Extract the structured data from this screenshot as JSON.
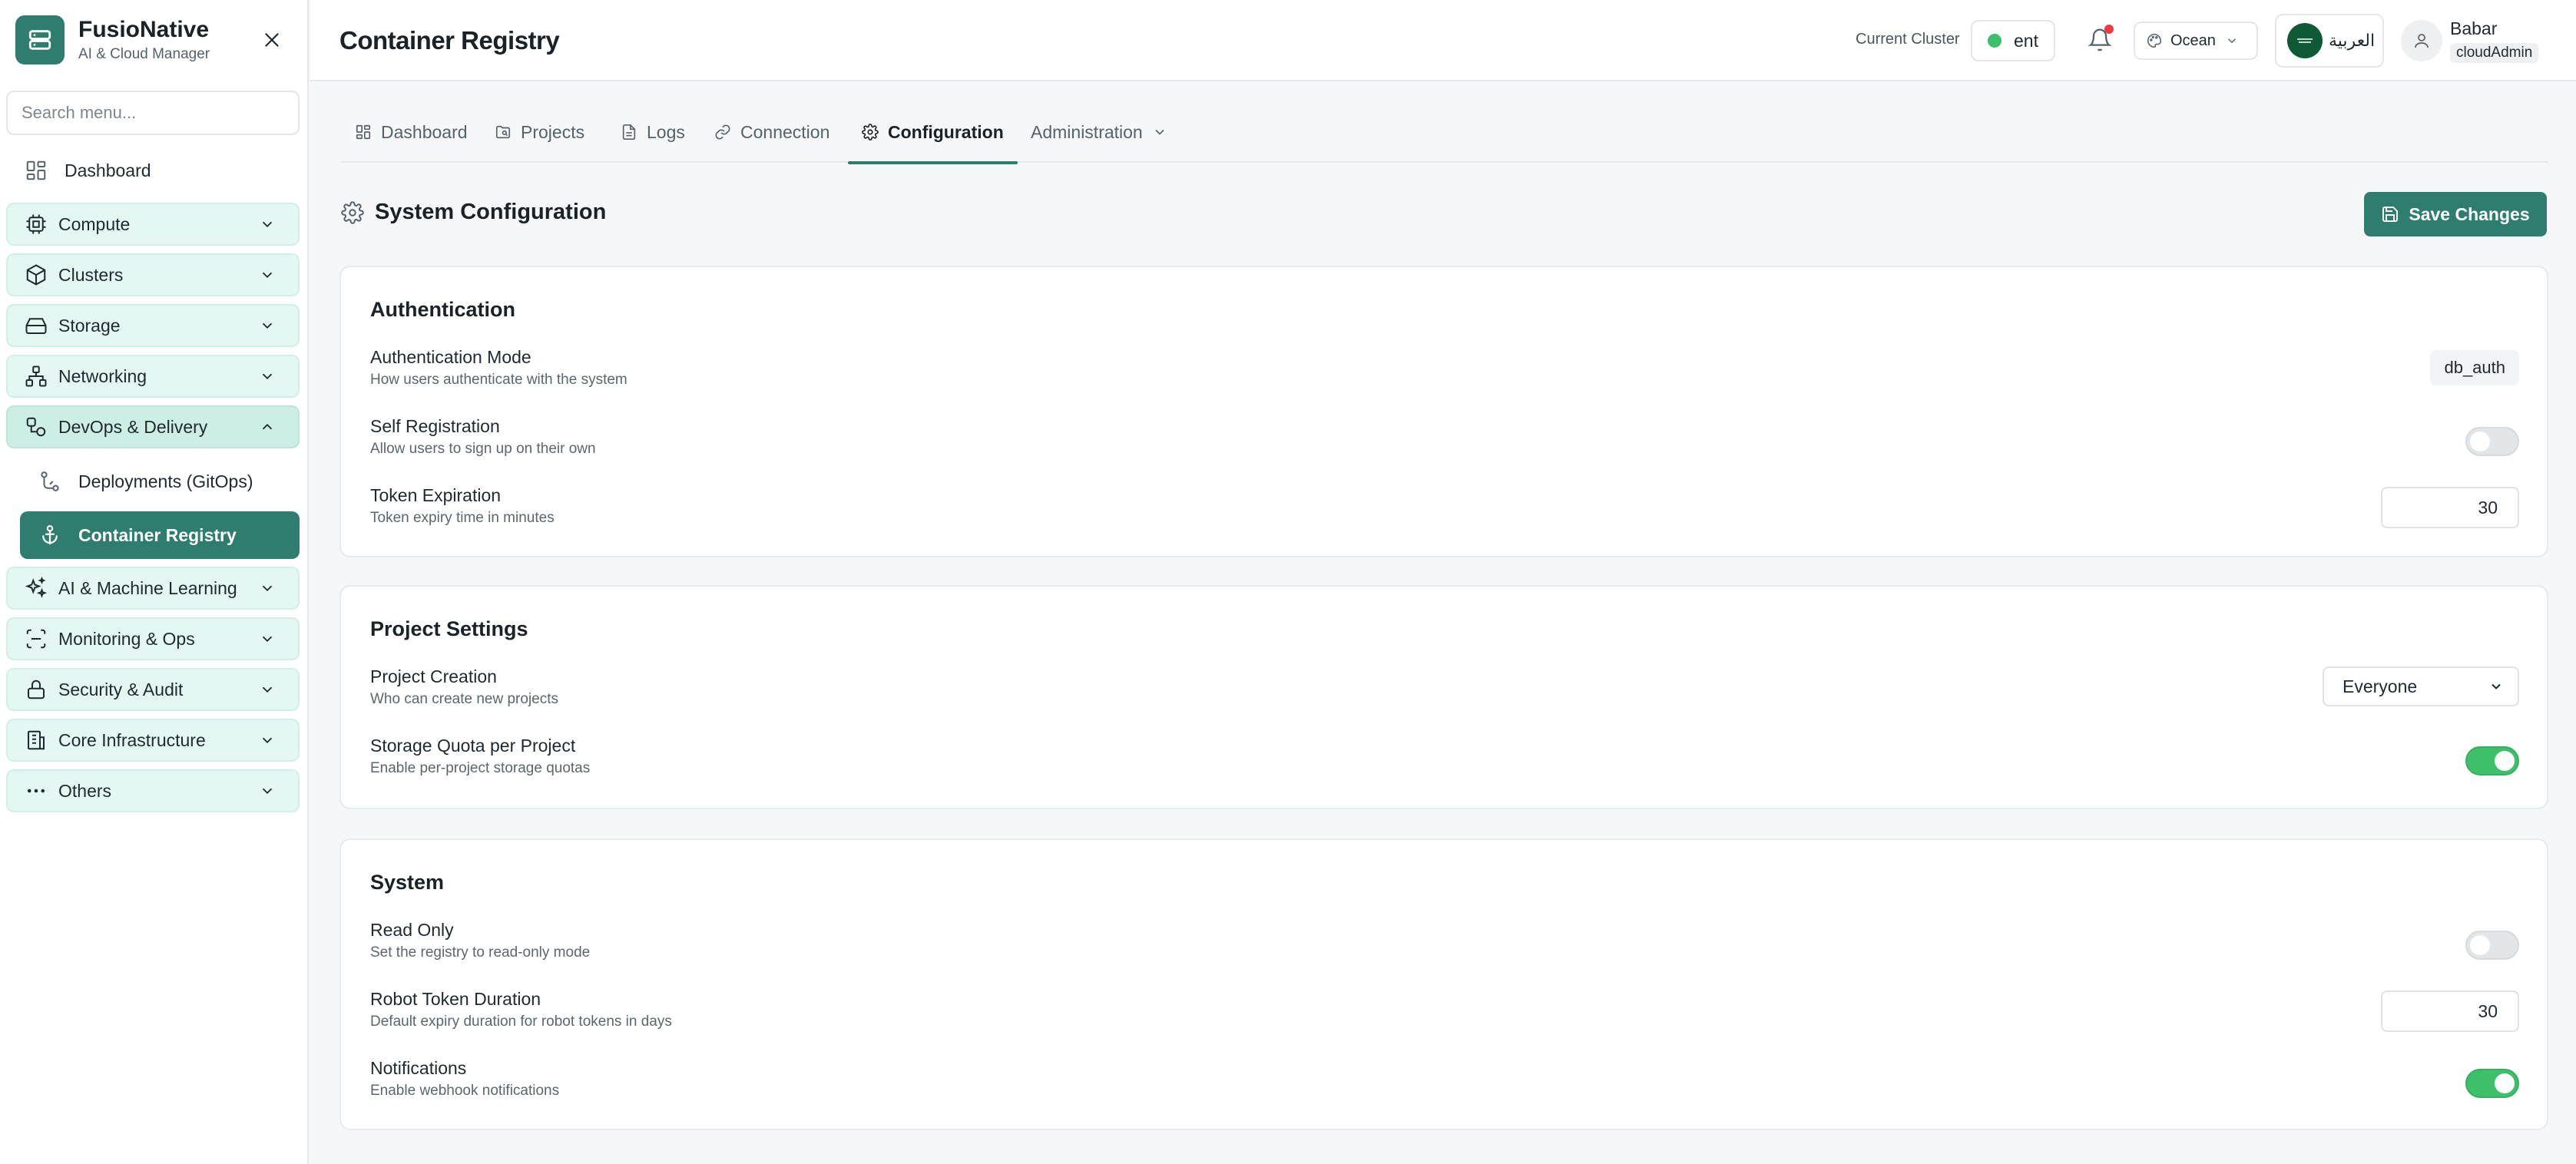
{
  "brand": {
    "name": "FusioNative",
    "subtitle": "AI & Cloud Manager"
  },
  "sidebar": {
    "search_placeholder": "Search menu...",
    "dashboard_label": "Dashboard",
    "groups": [
      {
        "label": "Compute",
        "icon": "cpu-icon"
      },
      {
        "label": "Clusters",
        "icon": "cube-icon"
      },
      {
        "label": "Storage",
        "icon": "hard-drive-icon"
      },
      {
        "label": "Networking",
        "icon": "network-icon"
      },
      {
        "label": "DevOps & Delivery",
        "icon": "devops-icon",
        "expanded": true
      },
      {
        "label": "AI & Machine Learning",
        "icon": "sparkles-icon"
      },
      {
        "label": "Monitoring & Ops",
        "icon": "scan-icon"
      },
      {
        "label": "Security & Audit",
        "icon": "lock-icon"
      },
      {
        "label": "Core Infrastructure",
        "icon": "building-icon"
      },
      {
        "label": "Others",
        "icon": "ellipsis-icon"
      }
    ],
    "sub_items": [
      {
        "label": "Deployments (GitOps)",
        "icon": "git-branch-icon"
      },
      {
        "label": "Container Registry",
        "icon": "anchor-icon",
        "active": true
      }
    ]
  },
  "header": {
    "title": "Container Registry",
    "cluster_label": "Current Cluster",
    "cluster_name": "ent",
    "theme_label": "Ocean",
    "language_label": "العربية",
    "user_name": "Babar",
    "user_role": "cloudAdmin"
  },
  "tabs": [
    {
      "label": "Dashboard",
      "icon": "grid-icon"
    },
    {
      "label": "Projects",
      "icon": "folder-icon"
    },
    {
      "label": "Logs",
      "icon": "file-text-icon"
    },
    {
      "label": "Connection",
      "icon": "link-icon"
    },
    {
      "label": "Configuration",
      "icon": "gear-icon",
      "active": true
    },
    {
      "label": "Administration",
      "icon": "chevron-down-icon"
    }
  ],
  "config": {
    "title": "System Configuration",
    "save_label": "Save Changes",
    "authentication": {
      "title": "Authentication",
      "mode_label": "Authentication Mode",
      "mode_desc": "How users authenticate with the system",
      "mode_value": "db_auth",
      "self_reg_label": "Self Registration",
      "self_reg_desc": "Allow users to sign up on their own",
      "self_reg_enabled": false,
      "token_label": "Token Expiration",
      "token_desc": "Token expiry time in minutes",
      "token_value": "30"
    },
    "project_settings": {
      "title": "Project Settings",
      "creation_label": "Project Creation",
      "creation_desc": "Who can create new projects",
      "creation_value": "Everyone",
      "quota_label": "Storage Quota per Project",
      "quota_desc": "Enable per-project storage quotas",
      "quota_enabled": true
    },
    "system": {
      "title": "System",
      "readonly_label": "Read Only",
      "readonly_desc": "Set the registry to read-only mode",
      "readonly_enabled": false,
      "robot_label": "Robot Token Duration",
      "robot_desc": "Default expiry duration for robot tokens in days",
      "robot_value": "30",
      "notif_label": "Notifications",
      "notif_desc": "Enable webhook notifications",
      "notif_enabled": true
    }
  },
  "colors": {
    "accent": "#2e7d6f",
    "nav_group_bg": "#e4f7f2",
    "toggle_on": "#3ec06b",
    "status_online": "#3ec06b",
    "notification_badge": "#ef3b3b"
  }
}
